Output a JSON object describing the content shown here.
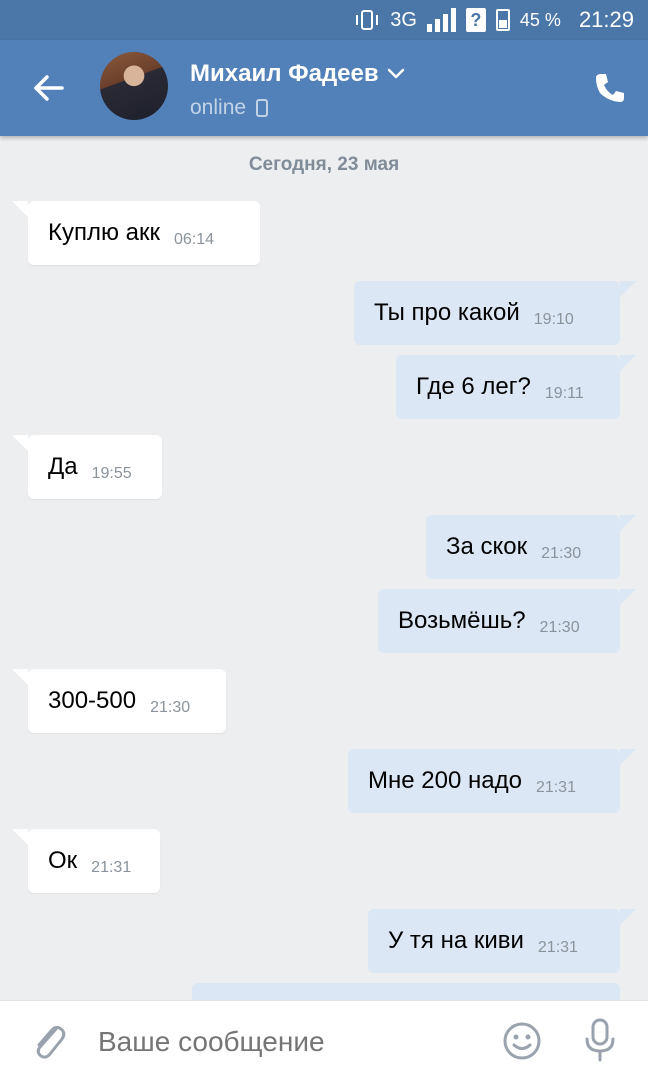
{
  "status_bar": {
    "network": "3G",
    "battery": "45 %",
    "time": "21:29",
    "battery_level": 0.45
  },
  "header": {
    "contact_name": "Михаил Фадеев",
    "status": "online",
    "back_icon": "arrow-left-icon",
    "call_icon": "phone-icon"
  },
  "chat": {
    "date_label": "Сегодня, 23 мая",
    "messages": [
      {
        "dir": "in",
        "text": "Куплю акк",
        "time": "06:14"
      },
      {
        "dir": "out",
        "text": "Ты про какой",
        "time": "19:10"
      },
      {
        "dir": "out",
        "text": "Где 6 лег?",
        "time": "19:11"
      },
      {
        "dir": "in",
        "text": "Да",
        "time": "19:55"
      },
      {
        "dir": "out",
        "text": "За скок",
        "time": "21:30"
      },
      {
        "dir": "out",
        "text": "Возьмёшь?",
        "time": "21:30"
      },
      {
        "dir": "in",
        "text": "300-500",
        "time": "21:30"
      },
      {
        "dir": "out",
        "text": "Мне 200 надо",
        "time": "21:31"
      },
      {
        "dir": "in",
        "text": "Ок",
        "time": "21:31"
      },
      {
        "dir": "out",
        "text": "У тя на киви",
        "time": "21:31"
      }
    ]
  },
  "composer": {
    "placeholder": "Ваше сообщение",
    "attach_icon": "paperclip-icon",
    "emoji_icon": "smile-icon",
    "voice_icon": "microphone-icon"
  },
  "colors": {
    "header_bg": "#5181b8",
    "statusbar_bg": "#4a76a8",
    "chat_bg": "#edeef0",
    "outgoing_bubble": "#dce7f5",
    "incoming_bubble": "#ffffff"
  }
}
